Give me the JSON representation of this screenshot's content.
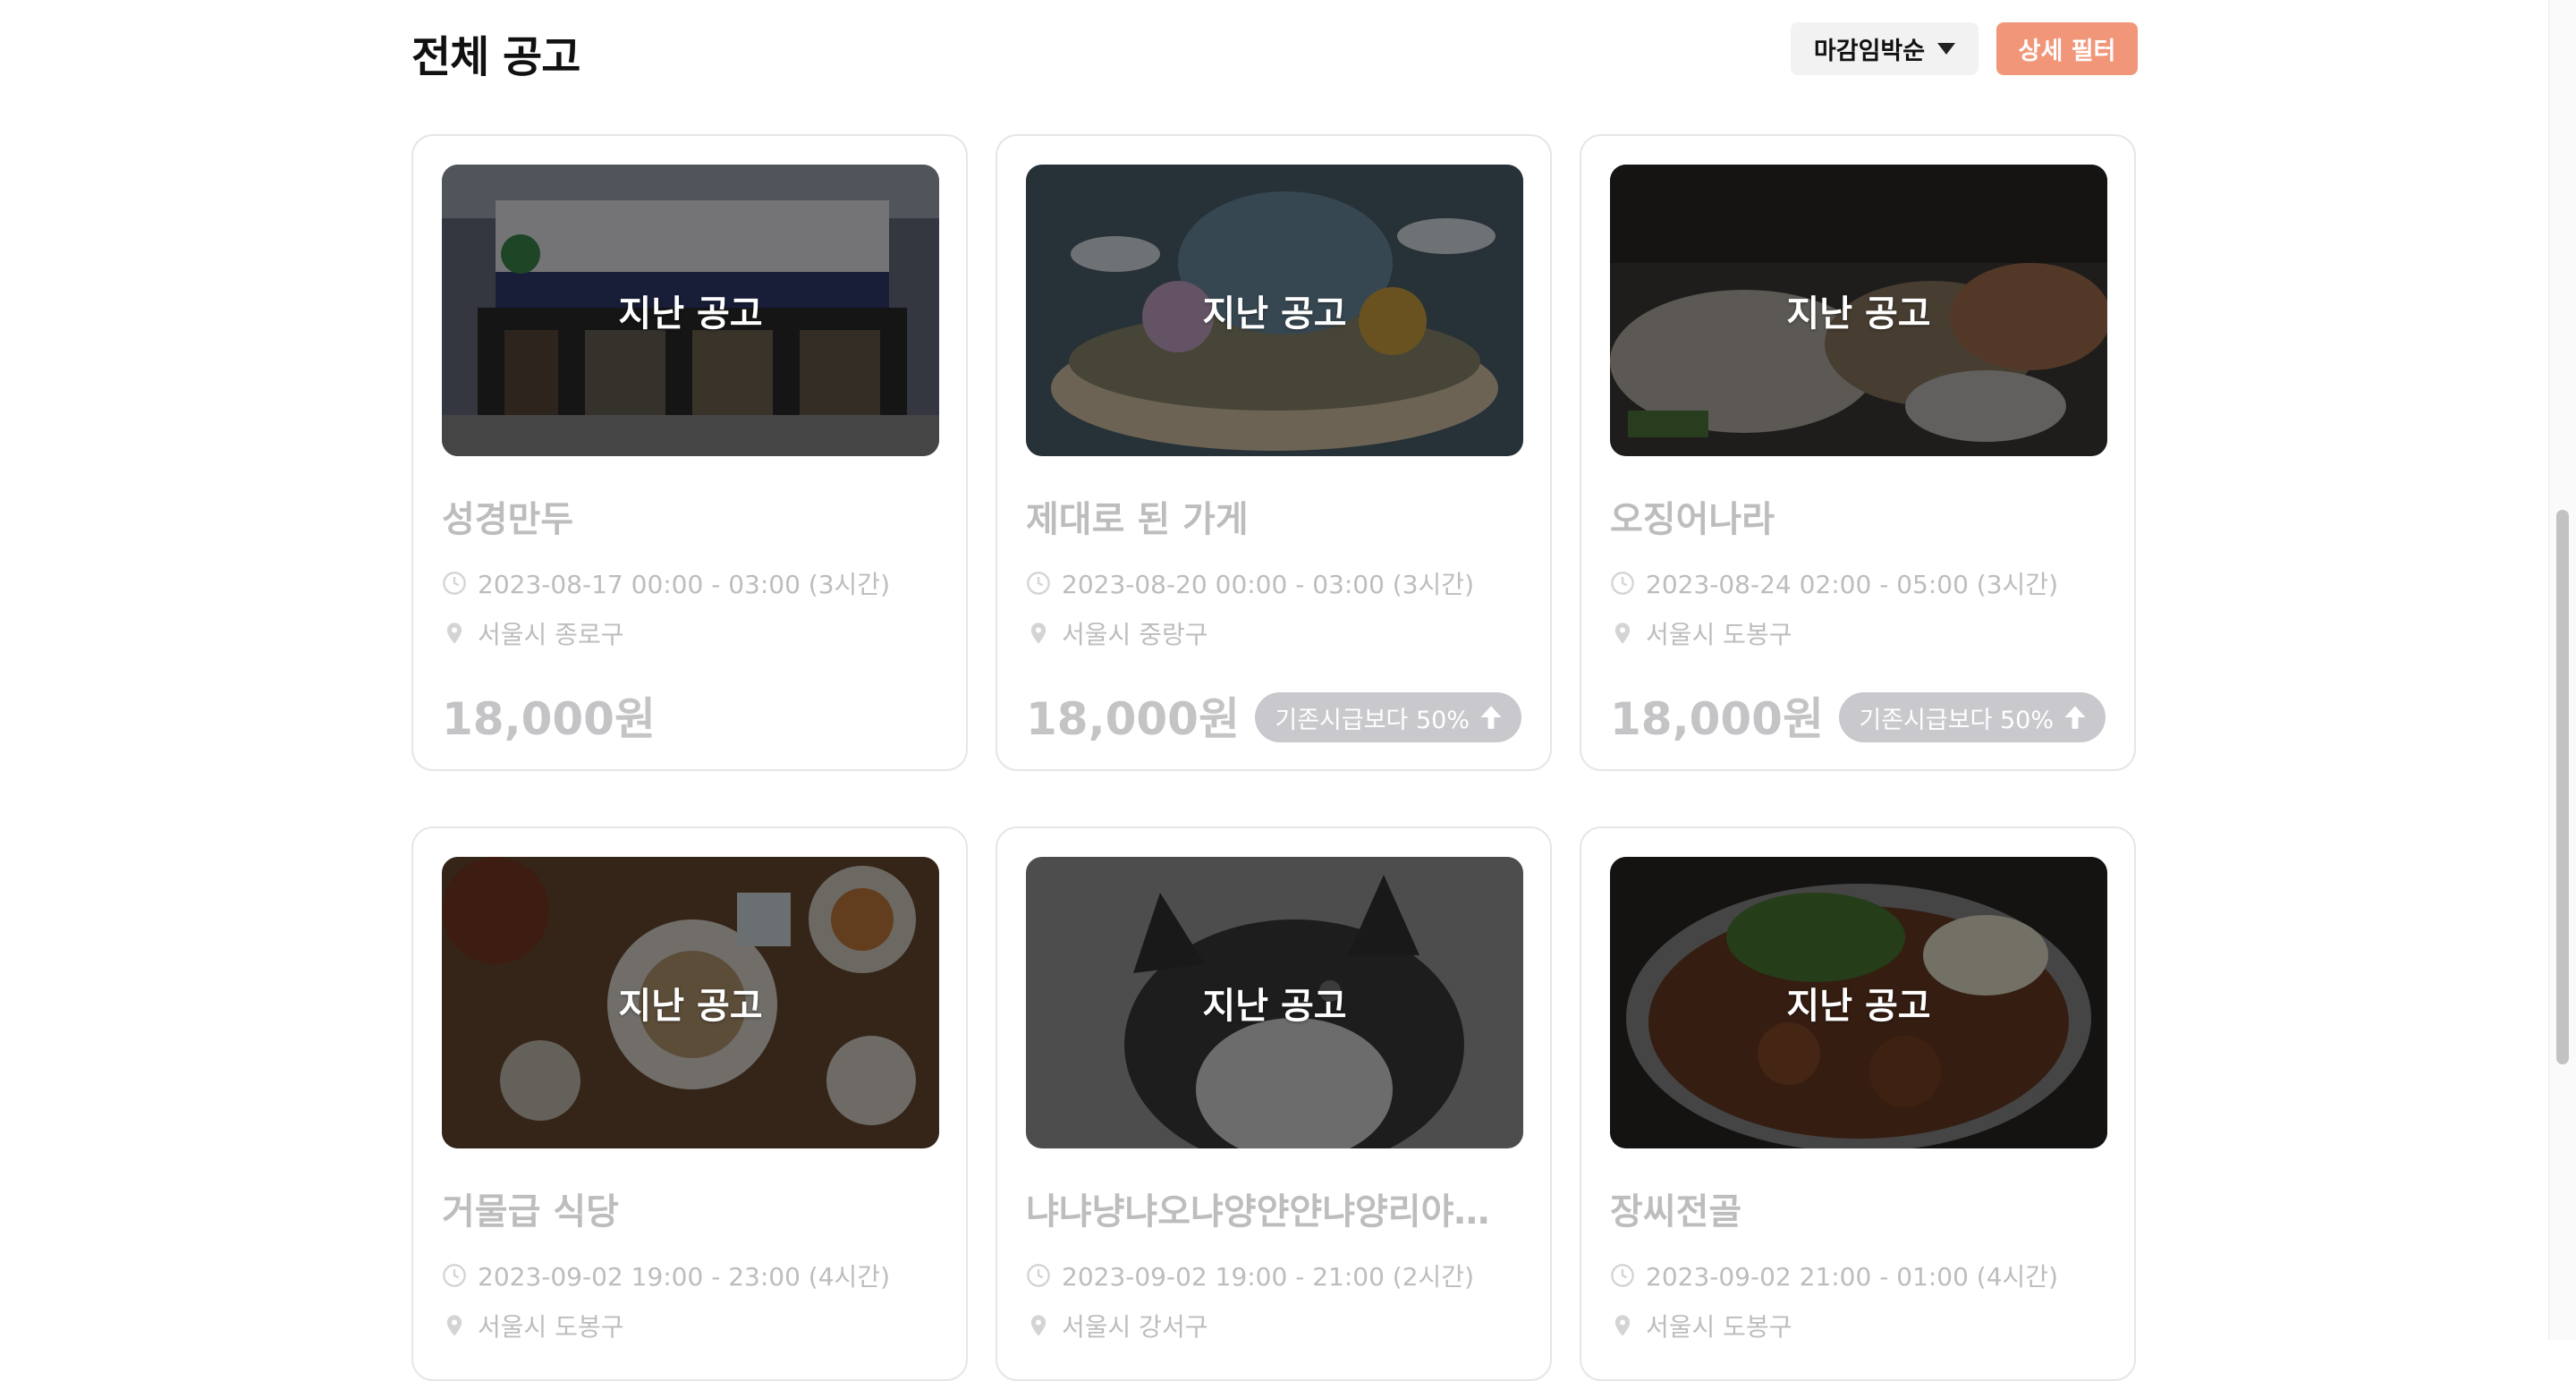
{
  "header": {
    "title": "전체 공고",
    "sort_label": "마감임박순",
    "filter_label": "상세 필터"
  },
  "colors": {
    "accent": "#f2967a",
    "muted_text": "#bdbdbd",
    "badge": "#c9c8cd"
  },
  "cards": [
    {
      "name": "성경만두",
      "status": "지난 공고",
      "time": "2023-08-17 00:00 - 03:00 (3시간)",
      "location": "서울시 종로구",
      "wage": "18,000원",
      "badge": ""
    },
    {
      "name": "제대로 된 가게",
      "status": "지난 공고",
      "time": "2023-08-20 00:00 - 03:00 (3시간)",
      "location": "서울시 중랑구",
      "wage": "18,000원",
      "badge": "기존시급보다 50%"
    },
    {
      "name": "오징어나라",
      "status": "지난 공고",
      "time": "2023-08-24 02:00 - 05:00 (3시간)",
      "location": "서울시 도봉구",
      "wage": "18,000원",
      "badge": "기존시급보다 50%"
    },
    {
      "name": "거물급 식당",
      "status": "지난 공고",
      "time": "2023-09-02 19:00 - 23:00 (4시간)",
      "location": "서울시 도봉구",
      "wage": "",
      "badge": ""
    },
    {
      "name": "냐냐냥냐오냐양얀얀냐양리야…",
      "status": "지난 공고",
      "time": "2023-09-02 19:00 - 21:00 (2시간)",
      "location": "서울시 강서구",
      "wage": "",
      "badge": ""
    },
    {
      "name": "장씨전골",
      "status": "지난 공고",
      "time": "2023-09-02 21:00 - 01:00 (4시간)",
      "location": "서울시 도봉구",
      "wage": "",
      "badge": ""
    }
  ]
}
